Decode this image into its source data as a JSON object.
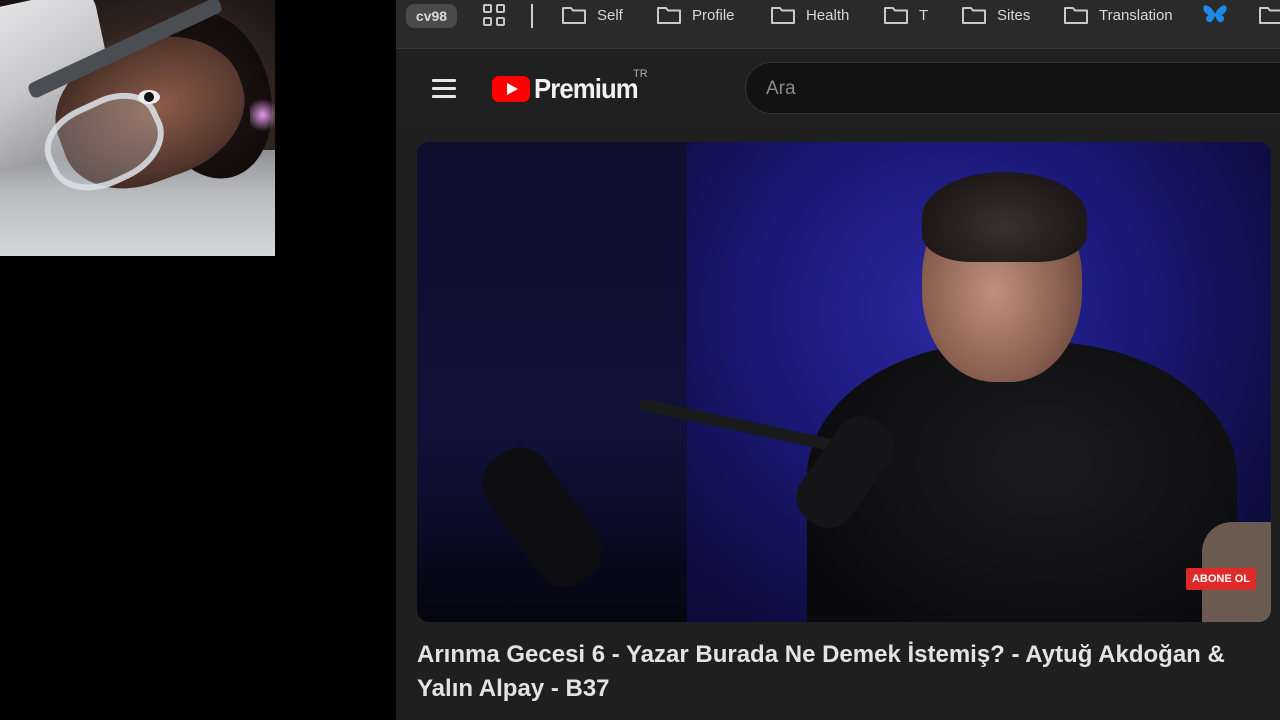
{
  "bookmarks_bar": {
    "profile_label": "cv98",
    "items": [
      {
        "label": "Self"
      },
      {
        "label": "Profile"
      },
      {
        "label": "Health"
      },
      {
        "label": "T"
      },
      {
        "label": "Sites"
      },
      {
        "label": "Translation"
      }
    ]
  },
  "header": {
    "logo_text": "Premium",
    "region": "TR",
    "search_placeholder": "Ara"
  },
  "player": {
    "subscribe_badge": "ABONE OL"
  },
  "video": {
    "title": "Arınma Gecesi 6 - Yazar Burada Ne Demek İstemiş? - Aytuğ Akdoğan & Yalın Alpay - B37"
  },
  "colors": {
    "accent_red": "#ff0000",
    "bookmark_bar_bg": "#2a2a2a",
    "page_bg": "#1f1f1f",
    "butterfly_blue": "#1e88e5"
  }
}
